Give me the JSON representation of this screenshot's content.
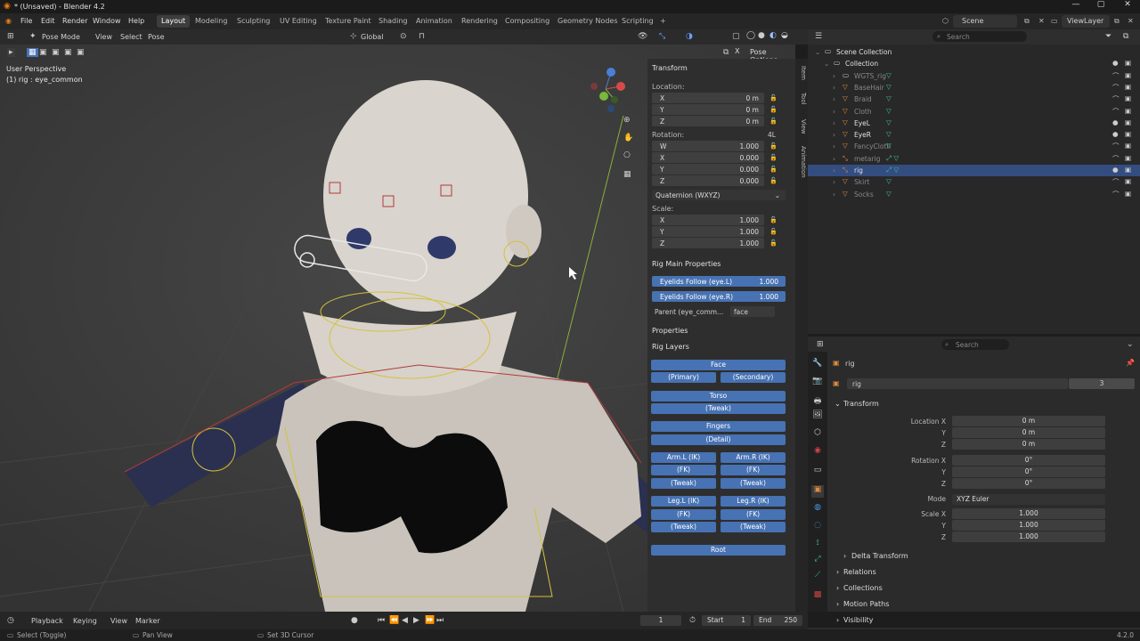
{
  "window": {
    "title": "* (Unsaved) - Blender 4.2",
    "min": "—",
    "max": "▢",
    "close": "✕"
  },
  "menus": [
    "File",
    "Edit",
    "Render",
    "Window",
    "Help"
  ],
  "workspaces": [
    "Layout",
    "Modeling",
    "Sculpting",
    "UV Editing",
    "Texture Paint",
    "Shading",
    "Animation",
    "Rendering",
    "Compositing",
    "Geometry Nodes",
    "Scripting",
    "+"
  ],
  "topright": {
    "scene": "Scene",
    "viewlayer": "ViewLayer"
  },
  "vpheader": {
    "mode": "Pose Mode",
    "view": "View",
    "select": "Select",
    "pose": "Pose",
    "orient": "Global",
    "pose_options": "Pose Options"
  },
  "viewport": {
    "perspective": "User Perspective",
    "active": "(1) rig : eye_common"
  },
  "ntabs": [
    "Item",
    "Tool",
    "View",
    "Animation"
  ],
  "transform": {
    "title": "Transform",
    "location_label": "Location:",
    "location": [
      {
        "k": "X",
        "v": "0 m"
      },
      {
        "k": "Y",
        "v": "0 m"
      },
      {
        "k": "Z",
        "v": "0 m"
      }
    ],
    "rotation_label": "Rotation:",
    "rotation_mode_tag": "4L",
    "rotation": [
      {
        "k": "W",
        "v": "1.000"
      },
      {
        "k": "X",
        "v": "0.000"
      },
      {
        "k": "Y",
        "v": "0.000"
      },
      {
        "k": "Z",
        "v": "0.000"
      }
    ],
    "rotation_mode": "Quaternion (WXYZ)",
    "scale_label": "Scale:",
    "scale": [
      {
        "k": "X",
        "v": "1.000"
      },
      {
        "k": "Y",
        "v": "1.000"
      },
      {
        "k": "Z",
        "v": "1.000"
      }
    ]
  },
  "rigmain": {
    "title": "Rig Main Properties",
    "follow_l_label": "Eyelids Follow (eye.L)",
    "follow_l": "1.000",
    "follow_r_label": "Eyelids Follow (eye.R)",
    "follow_r": "1.000",
    "parent_label": "Parent (eye_comm...",
    "parent_value": "face",
    "properties": "Properties"
  },
  "riglayers": {
    "title": "Rig Layers",
    "face": "Face",
    "primary": "(Primary)",
    "secondary": "(Secondary)",
    "torso": "Torso",
    "tweak": "(Tweak)",
    "fingers": "Fingers",
    "detail": "(Detail)",
    "arml_ik": "Arm.L (IK)",
    "armr_ik": "Arm.R (IK)",
    "fk": "(FK)",
    "legl_ik": "Leg.L (IK)",
    "legr_ik": "Leg.R (IK)",
    "root": "Root"
  },
  "outliner": {
    "search": "Search",
    "rows": [
      {
        "name": "Scene Collection",
        "indent": 0,
        "icon": "collection"
      },
      {
        "name": "Collection",
        "indent": 1,
        "icon": "collection"
      },
      {
        "name": "WGTS_rig",
        "indent": 2,
        "icon": "collection",
        "dim": true
      },
      {
        "name": "BaseHair",
        "indent": 2,
        "icon": "mesh",
        "dim": true
      },
      {
        "name": "Braid",
        "indent": 2,
        "icon": "mesh",
        "dim": true
      },
      {
        "name": "Cloth",
        "indent": 2,
        "icon": "mesh",
        "dim": true
      },
      {
        "name": "EyeL",
        "indent": 2,
        "icon": "mesh"
      },
      {
        "name": "EyeR",
        "indent": 2,
        "icon": "mesh"
      },
      {
        "name": "FancyCloth",
        "indent": 2,
        "icon": "mesh",
        "dim": true
      },
      {
        "name": "metarig",
        "indent": 2,
        "icon": "armature",
        "dim": true
      },
      {
        "name": "rig",
        "indent": 2,
        "icon": "armature",
        "selected": true
      },
      {
        "name": "Skirt",
        "indent": 2,
        "icon": "mesh",
        "dim": true
      },
      {
        "name": "Socks",
        "indent": 2,
        "icon": "mesh",
        "dim": true
      }
    ]
  },
  "properties": {
    "search": "Search",
    "object": "rig",
    "datablock": "rig",
    "users": "3",
    "transform": "Transform",
    "location_x_label": "Location X",
    "rotation_x_label": "Rotation X",
    "scale_x_label": "Scale X",
    "y": "Y",
    "z": "Z",
    "location": [
      "0 m",
      "0 m",
      "0 m"
    ],
    "rotation": [
      "0°",
      "0°",
      "0°"
    ],
    "mode_label": "Mode",
    "mode": "XYZ Euler",
    "scale": [
      "1.000",
      "1.000",
      "1.000"
    ],
    "delta": "Delta Transform",
    "relations": "Relations",
    "collections": "Collections",
    "motion_paths": "Motion Paths",
    "visibility": "Visibility"
  },
  "timeline": {
    "playback": "Playback",
    "keying": "Keying",
    "view": "View",
    "marker": "Marker",
    "frame": "1",
    "start_label": "Start",
    "start": "1",
    "end_label": "End",
    "end": "250"
  },
  "status": {
    "select": "Select (Toggle)",
    "pan": "Pan View",
    "cursor": "Set 3D Cursor",
    "version": "4.2.0"
  },
  "colors": {
    "accent": "#4772b3",
    "selected_row": "#334d80",
    "mesh_icon": "#e08a3c",
    "data_icon": "#3cbfa0"
  }
}
